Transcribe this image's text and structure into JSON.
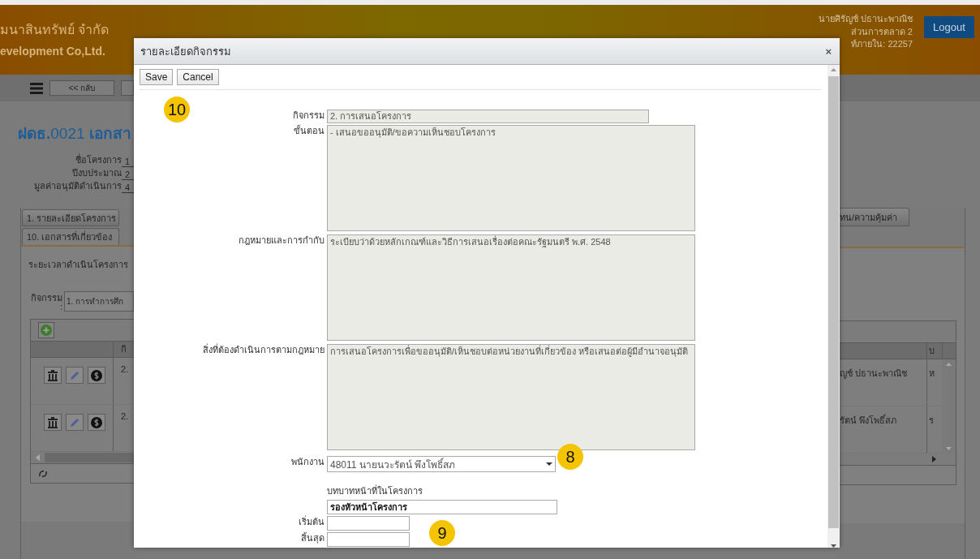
{
  "header": {
    "company_name": "มนาสินทรัพย์ จำกัด",
    "company_name_en": "evelopment Co,Ltd.",
    "user_name": "นายศิรัญช์ ปธานะพาณิช",
    "department": "ส่วนการตลาด 2",
    "phone": "ท์ภายใน: 22257",
    "logout": "Logout"
  },
  "toolbar": {
    "back_button": "<< กลับ"
  },
  "page": {
    "title": "**ฝดธ.**0021 **เอกสา**",
    "fields": [
      {
        "label": "ชื่อโครงการ",
        "value": "1"
      },
      {
        "label": "ปีงบประมาณ",
        "value": "2"
      },
      {
        "label": "มูลค่าอนุมัติดำเนินการ",
        "value": "4"
      }
    ],
    "tabs": [
      {
        "label": "1. รายละเอียดโครงการ",
        "selected": false
      },
      {
        "label": "10. เอกสารที่เกี่ยวข้อง",
        "selected": true
      },
      {
        "label": "ทน/ความคุ้มค่า",
        "selected": false
      }
    ],
    "section_label": "ระยะเวลาดำเนินโครงการ",
    "activity_filter": {
      "label": "กิจกรรม",
      "colon": ":",
      "value": "1. การทำการศึก"
    },
    "grid": {
      "columns": [
        "กิ",
        "",
        "บ"
      ],
      "rows": [
        {
          "cells": [
            "2.",
            "ญช์ ปธานะพาณิช",
            "ห"
          ]
        },
        {
          "cells": [
            "2.",
            "รัตน์ พึงโพธิ์สภ",
            "ร"
          ]
        }
      ]
    }
  },
  "modal": {
    "title": "รายละเอียดกิจกรรม",
    "close": "×",
    "buttons": [
      "Save",
      "Cancel"
    ],
    "fields": [
      {
        "kind": "input",
        "label": "กิจกรรม",
        "value": "2. การเสนอโครงการ"
      },
      {
        "kind": "textarea",
        "label": "ขั้นตอน",
        "value": "- เสนอขออนุมัติ/ขอความเห็นชอบโครงการ"
      },
      {
        "kind": "textarea",
        "label": "กฎหมายและการกำกับ",
        "value": "ระเบียบว่าด้วยหลักเกณฑ์และวิธีการเสนอเรื่องต่อคณะรัฐมนตรี พ.ศ. 2548"
      },
      {
        "kind": "textarea",
        "label": "สิ่งที่ต้องดำเนินการตามกฎหมาย",
        "value": "การเสนอโครงการเพื่อขออนุมัติ/เห็นชอบต่อหน่วยงานที่เกี่ยวข้อง หรือเสนอต่อผู้มีอำนาจอนุมัติ"
      },
      {
        "kind": "select",
        "label": "พนักงาน",
        "value": "48011 นายนวะรัตน์ พึงโพธิ์สภ"
      },
      {
        "kind": "stacked",
        "label": "บทบาทหน้าที่ในโครงการ",
        "value": "รองหัวหน้าโครงการ"
      },
      {
        "kind": "date",
        "label": "เริ่มต้น"
      },
      {
        "kind": "date",
        "label": "สิ้นสุด"
      }
    ],
    "callouts": [
      {
        "number": "10"
      },
      {
        "number": "8"
      },
      {
        "number": "9"
      }
    ]
  }
}
